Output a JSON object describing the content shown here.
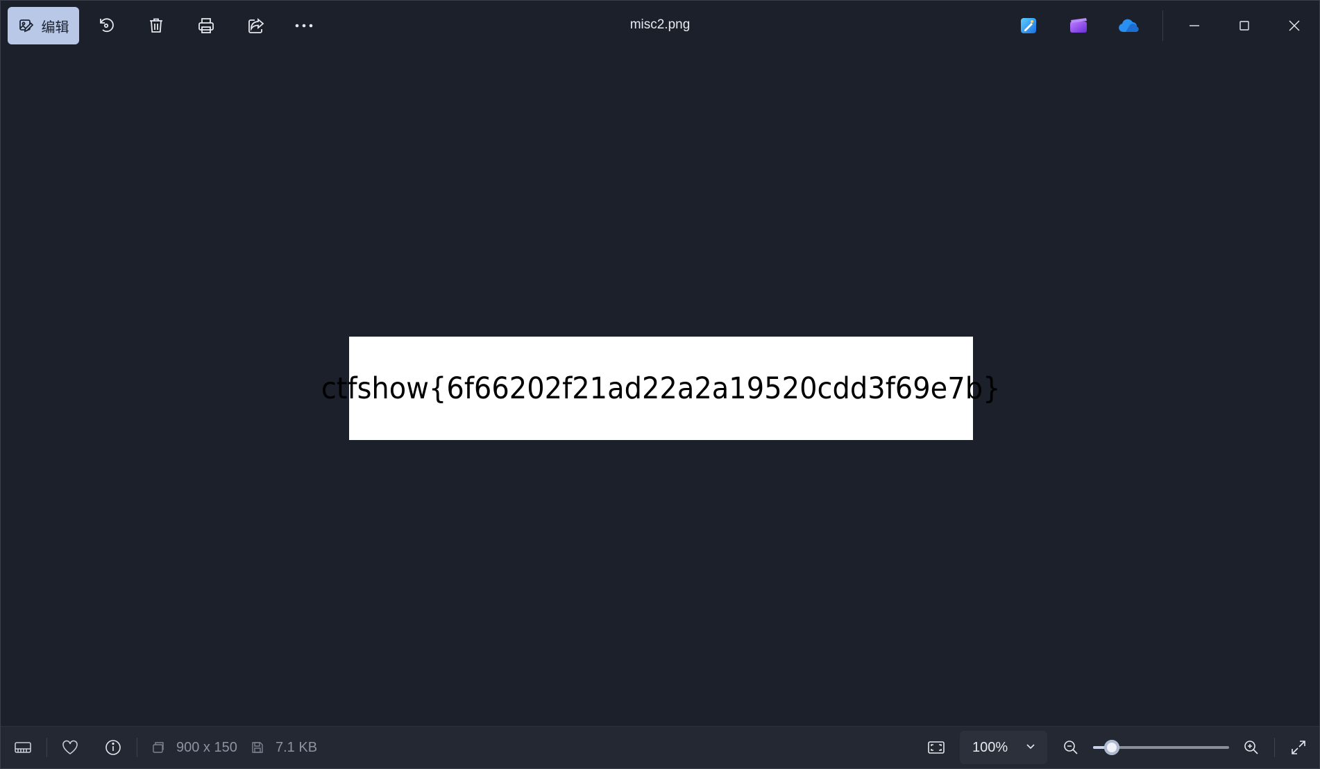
{
  "toolbar": {
    "edit_label": "编辑",
    "title": "misc2.png",
    "icons": [
      "edit-image-icon",
      "rotate-icon",
      "delete-icon",
      "print-icon",
      "share-icon",
      "more-icon"
    ],
    "app_icons": [
      "photos-editor-icon",
      "clipchamp-icon",
      "onedrive-icon"
    ]
  },
  "window_controls": [
    "minimize-icon",
    "maximize-icon",
    "close-icon"
  ],
  "image": {
    "text": "ctfshow{6f66202f21ad22a2a19520cdd3f69e7b}"
  },
  "statusbar": {
    "dimensions": "900 x 150",
    "file_size": "7.1 KB",
    "zoom_value": "100%",
    "zoom_slider_fraction": 0.14,
    "icons": [
      "filmstrip-icon",
      "favorite-icon",
      "info-icon",
      "dimensions-icon",
      "save-icon",
      "fit-to-window-icon",
      "chevron-down-icon",
      "zoom-out-icon",
      "zoom-in-icon",
      "fullscreen-icon"
    ]
  },
  "colors": {
    "background": "#1b202b",
    "edit_button": "#b9c8e6",
    "onedrive": "#2a8ff0",
    "clipchamp": "#8a4fe0"
  }
}
